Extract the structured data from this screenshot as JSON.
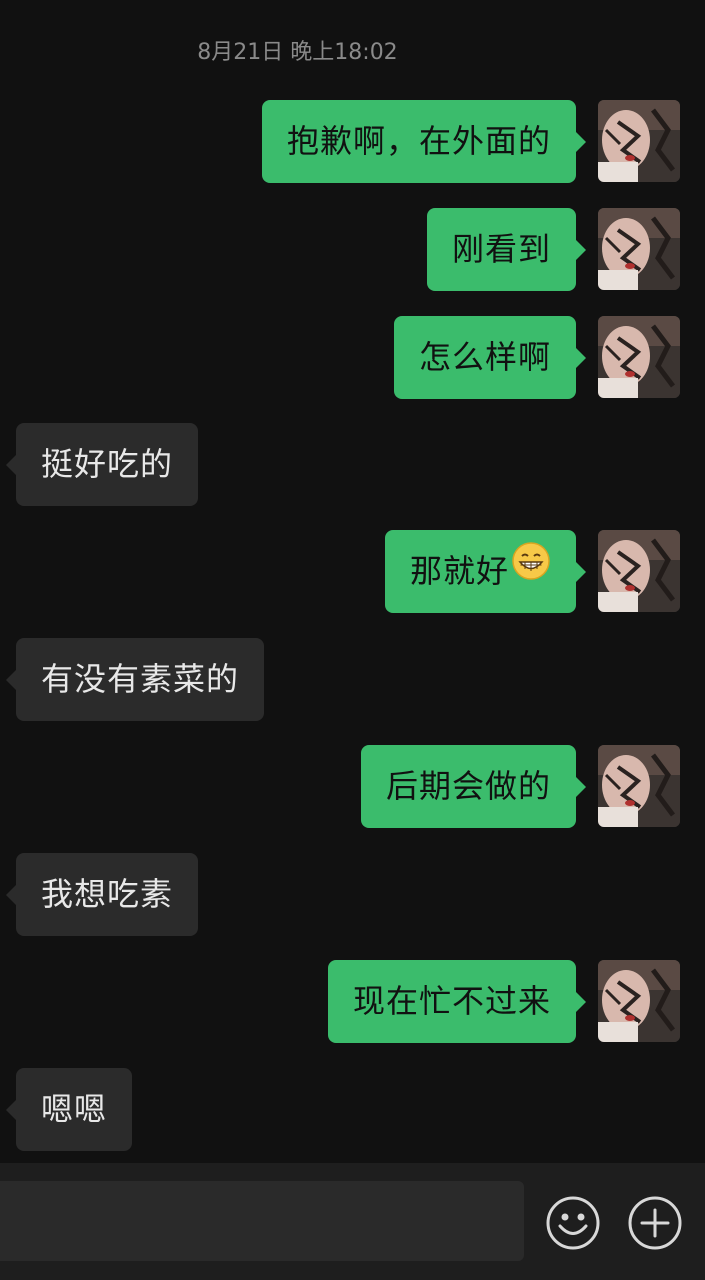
{
  "timestamp": "8月21日 晚上18:02",
  "messages": [
    {
      "side": "out",
      "text": "抱歉啊，在外面的"
    },
    {
      "side": "out",
      "text": "刚看到"
    },
    {
      "side": "out",
      "text": "怎么样啊"
    },
    {
      "side": "in",
      "text": "挺好吃的"
    },
    {
      "side": "out",
      "text": "那就好",
      "emoji": "grin-emoji"
    },
    {
      "side": "in",
      "text": "有没有素菜的"
    },
    {
      "side": "out",
      "text": "后期会做的"
    },
    {
      "side": "in",
      "text": "我想吃素"
    },
    {
      "side": "out",
      "text": "现在忙不过来"
    },
    {
      "side": "in",
      "text": "嗯嗯"
    }
  ],
  "input_bar": {
    "value": "",
    "placeholder": "",
    "icons": [
      "smiley-face-icon",
      "plus-circle-icon"
    ]
  },
  "colors": {
    "background": "#111111",
    "outgoing_bubble": "#3bbc6c",
    "incoming_bubble": "#2b2b2b",
    "timestamp_text": "#8a8a8a"
  }
}
